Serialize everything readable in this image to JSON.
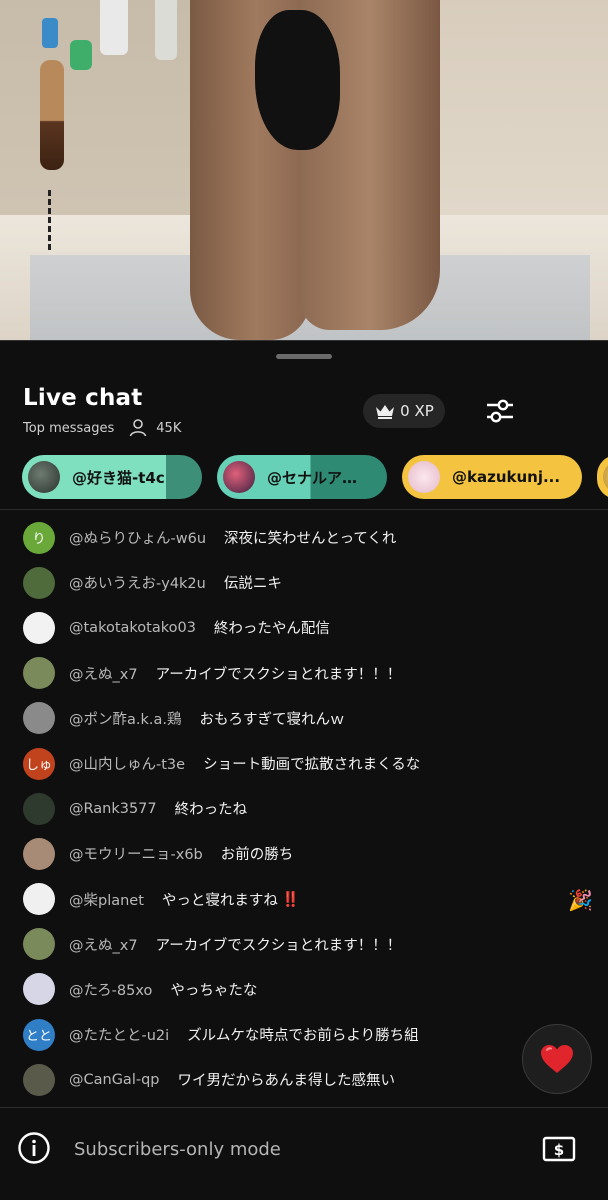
{
  "chat": {
    "title": "Live chat",
    "mode": "Top messages",
    "viewer_count": "45K",
    "xp_label": "0 XP"
  },
  "pinned_chips": [
    {
      "label": "@好き猫-t4c",
      "avatar_color": "#3a4a44"
    },
    {
      "label": "@セナルア…",
      "avatar_color": "#a33a5a"
    },
    {
      "label": "@kazukunj...",
      "avatar_color": "#f1d6e0"
    },
    {
      "label": "",
      "avatar_color": "#e0b060"
    }
  ],
  "messages": [
    {
      "author": "@ぬらりひょん-w6u",
      "text": "深夜に笑わせんとってくれ",
      "avatar_letter": "り",
      "avatar_color": "#6aa83a"
    },
    {
      "author": "@あいうえお-y4k2u",
      "text": "伝説ニキ",
      "avatar_letter": "",
      "avatar_color": "#4f6a3b"
    },
    {
      "author": "@takotakotako03",
      "text": "終わったやん配信",
      "avatar_letter": "",
      "avatar_color": "#f2f2f2"
    },
    {
      "author": "@えぬ_x7",
      "text": "アーカイブでスクショとれます！！！",
      "avatar_letter": "",
      "avatar_color": "#7a8a5a"
    },
    {
      "author": "@ポン酢a.k.a.鶏",
      "text": "おもろすぎて寝れんｗ",
      "avatar_letter": "",
      "avatar_color": "#8a8a8a"
    },
    {
      "author": "@山内しゅん-t3e",
      "text": "ショート動画で拡散されまくるな",
      "avatar_letter": "しゅ",
      "avatar_color": "#c1431d"
    },
    {
      "author": "@Rank3577",
      "text": "終わったね",
      "avatar_letter": "",
      "avatar_color": "#2f3a2f"
    },
    {
      "author": "@モウリーニョ-x6b",
      "text": "お前の勝ち",
      "avatar_letter": "",
      "avatar_color": "#a88b76"
    },
    {
      "author": "@柴planet",
      "text": "やっと寝れますね",
      "avatar_letter": "",
      "avatar_color": "#f0f0f0",
      "suffix": "‼️"
    },
    {
      "author": "@えぬ_x7",
      "text": "アーカイブでスクショとれます！！！",
      "avatar_letter": "",
      "avatar_color": "#7a8a5a"
    },
    {
      "author": "@たろ-85xo",
      "text": "やっちゃたな",
      "avatar_letter": "",
      "avatar_color": "#d6d6e6"
    },
    {
      "author": "@たたとと-u2i",
      "text": "ズルムケな時点でお前らより勝ち組",
      "avatar_letter": "とと",
      "avatar_color": "#2f7ec6"
    },
    {
      "author": "@CanGal-qp",
      "text": "ワイ男だからあんま得した感無い",
      "avatar_letter": "",
      "avatar_color": "#5a5a4a"
    }
  ],
  "bottom_bar": {
    "mode_text": "Subscribers-only mode"
  },
  "colors": {
    "background": "#0f0f0f",
    "chip_green": "#7fe0bf",
    "chip_gold": "#f4c441",
    "heart": "#e0252d"
  },
  "icons": {
    "viewers": "person-icon",
    "xp": "crown-icon",
    "filter": "sliders-icon",
    "heart": "heart-icon",
    "info": "info-icon",
    "super_chat": "dollar-bill-icon",
    "reaction": "party-popper-icon"
  }
}
